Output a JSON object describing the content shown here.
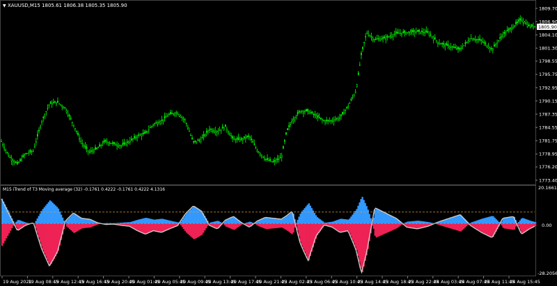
{
  "main_panel": {
    "arrow_glyph": "▼",
    "title": "XAUUSD,M15  1805.61 1806.38 1805.35 1805.90",
    "price_labels": [
      "1809.70",
      "1806.90",
      "1804.10",
      "1801.30",
      "1798.55",
      "1795.75",
      "1792.95",
      "1790.15",
      "1787.35",
      "1784.55",
      "1781.75",
      "1778.95",
      "1776.20",
      "1773.40"
    ],
    "current_price": "1805.90",
    "price_range": [
      1773.4,
      1809.7
    ],
    "candle_color": "#00ff00"
  },
  "indicator_panel": {
    "title": "M15 iTrend of T3 Moving average (32) -0.1761 0.4222 -0.1761 0.4222 4.1316",
    "top_label": "20.1661",
    "zero_label": "0.00",
    "bottom_label": "-28.2056",
    "range": [
      -28.2056,
      20.1661
    ],
    "blue_color": "#3399ff",
    "red_color": "#ee2255",
    "line_color": "#c8c8c8",
    "level_color": "#d29a3a"
  },
  "time_labels": [
    "19 Aug 2021",
    "19 Aug 08:45",
    "19 Aug 12:45",
    "19 Aug 16:45",
    "19 Aug 20:45",
    "20 Aug 01:45",
    "20 Aug 05:45",
    "20 Aug 09:45",
    "20 Aug 13:45",
    "20 Aug 17:45",
    "20 Aug 21:45",
    "23 Aug 02:45",
    "23 Aug 06:45",
    "23 Aug 10:45",
    "23 Aug 14:45",
    "23 Aug 18:45",
    "23 Aug 22:45",
    "24 Aug 03:45",
    "24 Aug 07:45",
    "24 Aug 11:45",
    "24 Aug 15:45"
  ],
  "chart_data": {
    "type": "candlestick",
    "symbol": "XAUUSD",
    "timeframe": "M15",
    "close_path": [
      [
        0,
        1781.6
      ],
      [
        0.015,
        1778.3
      ],
      [
        0.03,
        1776.8
      ],
      [
        0.045,
        1778.9
      ],
      [
        0.06,
        1779.6
      ],
      [
        0.075,
        1785.6
      ],
      [
        0.09,
        1789.5
      ],
      [
        0.105,
        1789.9
      ],
      [
        0.12,
        1788.6
      ],
      [
        0.135,
        1785.2
      ],
      [
        0.15,
        1781.4
      ],
      [
        0.165,
        1779.3
      ],
      [
        0.18,
        1780.1
      ],
      [
        0.195,
        1781.6
      ],
      [
        0.21,
        1781.1
      ],
      [
        0.225,
        1780.7
      ],
      [
        0.24,
        1781.6
      ],
      [
        0.255,
        1782.7
      ],
      [
        0.27,
        1783.3
      ],
      [
        0.285,
        1785.2
      ],
      [
        0.3,
        1785.9
      ],
      [
        0.315,
        1787.3
      ],
      [
        0.33,
        1787.7
      ],
      [
        0.345,
        1786.0
      ],
      [
        0.36,
        1781.4
      ],
      [
        0.375,
        1782.0
      ],
      [
        0.39,
        1784.2
      ],
      [
        0.405,
        1783.7
      ],
      [
        0.42,
        1784.7
      ],
      [
        0.435,
        1782.0
      ],
      [
        0.45,
        1782.0
      ],
      [
        0.465,
        1782.7
      ],
      [
        0.48,
        1779.7
      ],
      [
        0.495,
        1777.9
      ],
      [
        0.51,
        1777.2
      ],
      [
        0.525,
        1778.2
      ],
      [
        0.535,
        1783.7
      ],
      [
        0.545,
        1785.9
      ],
      [
        0.56,
        1788.0
      ],
      [
        0.575,
        1788.0
      ],
      [
        0.59,
        1787.0
      ],
      [
        0.605,
        1785.9
      ],
      [
        0.62,
        1786.0
      ],
      [
        0.635,
        1786.6
      ],
      [
        0.65,
        1789.0
      ],
      [
        0.665,
        1792.3
      ],
      [
        0.675,
        1800.0
      ],
      [
        0.685,
        1804.6
      ],
      [
        0.7,
        1803.1
      ],
      [
        0.72,
        1803.4
      ],
      [
        0.74,
        1804.4
      ],
      [
        0.76,
        1804.6
      ],
      [
        0.78,
        1804.8
      ],
      [
        0.8,
        1804.6
      ],
      [
        0.82,
        1802.4
      ],
      [
        0.84,
        1801.7
      ],
      [
        0.86,
        1801.0
      ],
      [
        0.88,
        1803.4
      ],
      [
        0.9,
        1802.9
      ],
      [
        0.92,
        1801.0
      ],
      [
        0.94,
        1804.1
      ],
      [
        0.96,
        1805.9
      ],
      [
        0.975,
        1807.4
      ],
      [
        0.99,
        1805.9
      ],
      [
        1.0,
        1805.9
      ]
    ],
    "indicator": {
      "blue_zero_level": 0,
      "line_path": [
        [
          0,
          14
        ],
        [
          0.015,
          5
        ],
        [
          0.03,
          -4
        ],
        [
          0.045,
          -1
        ],
        [
          0.06,
          0.5
        ],
        [
          0.075,
          -14
        ],
        [
          0.09,
          -24
        ],
        [
          0.105,
          -16
        ],
        [
          0.12,
          1.5
        ],
        [
          0.135,
          6
        ],
        [
          0.15,
          3
        ],
        [
          0.165,
          2.5
        ],
        [
          0.18,
          0.5
        ],
        [
          0.195,
          -0.5
        ],
        [
          0.21,
          -0.3
        ],
        [
          0.225,
          -1
        ],
        [
          0.24,
          -1.5
        ],
        [
          0.255,
          -4
        ],
        [
          0.27,
          -6
        ],
        [
          0.285,
          -4
        ],
        [
          0.3,
          -5
        ],
        [
          0.315,
          -3
        ],
        [
          0.33,
          -1.2
        ],
        [
          0.345,
          5.5
        ],
        [
          0.36,
          10
        ],
        [
          0.375,
          7
        ],
        [
          0.39,
          -1
        ],
        [
          0.405,
          -3
        ],
        [
          0.42,
          2
        ],
        [
          0.435,
          4
        ],
        [
          0.45,
          0.5
        ],
        [
          0.465,
          -2
        ],
        [
          0.48,
          1.5
        ],
        [
          0.495,
          3.5
        ],
        [
          0.51,
          3
        ],
        [
          0.525,
          2.5
        ],
        [
          0.535,
          4.5
        ],
        [
          0.545,
          7
        ],
        [
          0.56,
          -11
        ],
        [
          0.575,
          -21
        ],
        [
          0.59,
          -7
        ],
        [
          0.605,
          -0.8
        ],
        [
          0.62,
          -2
        ],
        [
          0.635,
          -5
        ],
        [
          0.65,
          -4
        ],
        [
          0.665,
          -15
        ],
        [
          0.675,
          -28
        ],
        [
          0.685,
          -16
        ],
        [
          0.7,
          9
        ],
        [
          0.72,
          6
        ],
        [
          0.74,
          3
        ],
        [
          0.76,
          -2
        ],
        [
          0.78,
          -3
        ],
        [
          0.8,
          -1.5
        ],
        [
          0.82,
          1
        ],
        [
          0.84,
          3
        ],
        [
          0.86,
          5
        ],
        [
          0.88,
          -1.2
        ],
        [
          0.9,
          -5
        ],
        [
          0.92,
          -8
        ],
        [
          0.94,
          3
        ],
        [
          0.96,
          4
        ],
        [
          0.975,
          -6
        ],
        [
          0.99,
          -3
        ],
        [
          1.0,
          -1.5
        ]
      ],
      "level_lines": [
        6.5,
        0
      ]
    }
  }
}
